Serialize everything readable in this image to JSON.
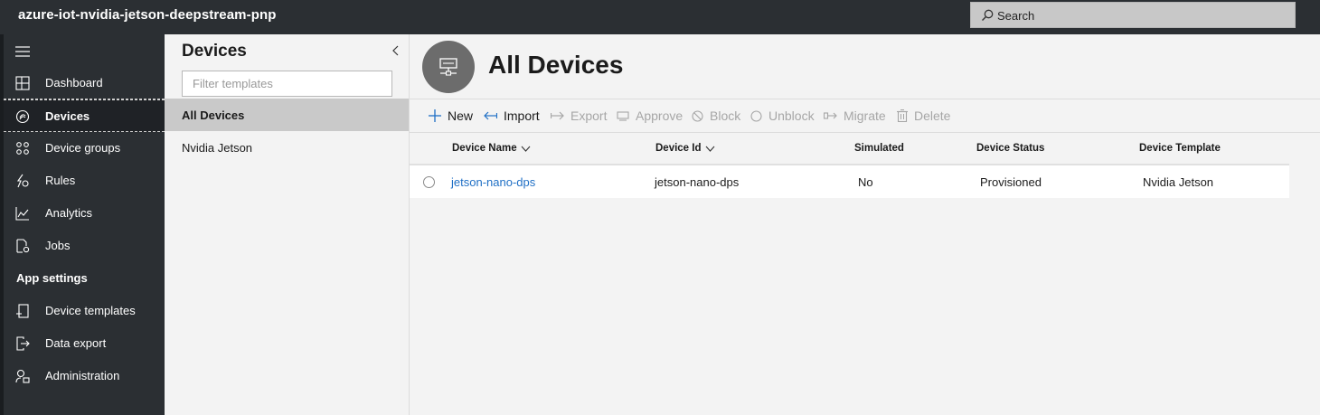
{
  "app": {
    "title": "azure-iot-nvidia-jetson-deepstream-pnp"
  },
  "search": {
    "placeholder": "Search",
    "icon": "search-icon"
  },
  "nav": {
    "menu_icon": "hamburger-icon",
    "items": [
      {
        "label": "Dashboard",
        "icon": "dashboard-icon"
      },
      {
        "label": "Devices",
        "icon": "devices-icon",
        "active": true
      },
      {
        "label": "Device groups",
        "icon": "device-groups-icon"
      },
      {
        "label": "Rules",
        "icon": "rules-icon"
      },
      {
        "label": "Analytics",
        "icon": "analytics-icon"
      },
      {
        "label": "Jobs",
        "icon": "jobs-icon"
      }
    ],
    "section_label": "App settings",
    "settings_items": [
      {
        "label": "Device templates",
        "icon": "device-templates-icon"
      },
      {
        "label": "Data export",
        "icon": "data-export-icon"
      },
      {
        "label": "Administration",
        "icon": "administration-icon"
      }
    ]
  },
  "templates_panel": {
    "title": "Devices",
    "filter_placeholder": "Filter templates",
    "items": [
      {
        "label": "All Devices",
        "selected": true
      },
      {
        "label": "Nvidia Jetson",
        "selected": false
      }
    ]
  },
  "main": {
    "title": "All Devices",
    "toolbar": [
      {
        "label": "New",
        "icon": "plus-icon",
        "enabled": true
      },
      {
        "label": "Import",
        "icon": "import-icon",
        "enabled": true
      },
      {
        "label": "Export",
        "icon": "export-icon",
        "enabled": false
      },
      {
        "label": "Approve",
        "icon": "approve-icon",
        "enabled": false
      },
      {
        "label": "Block",
        "icon": "block-icon",
        "enabled": false
      },
      {
        "label": "Unblock",
        "icon": "unblock-icon",
        "enabled": false
      },
      {
        "label": "Migrate",
        "icon": "migrate-icon",
        "enabled": false
      },
      {
        "label": "Delete",
        "icon": "trash-icon",
        "enabled": false
      }
    ],
    "table": {
      "columns": [
        "Device Name",
        "Device Id",
        "Simulated",
        "Device Status",
        "Device Template"
      ],
      "rows": [
        {
          "name": "jetson-nano-dps",
          "id": "jetson-nano-dps",
          "simulated": "No",
          "status": "Provisioned",
          "template": "Nvidia Jetson"
        }
      ]
    }
  },
  "colors": {
    "topbar": "#2b2f33",
    "link": "#1f6fc5",
    "selected_bg": "#c9c9c9",
    "accent": "#1f6fc5"
  }
}
